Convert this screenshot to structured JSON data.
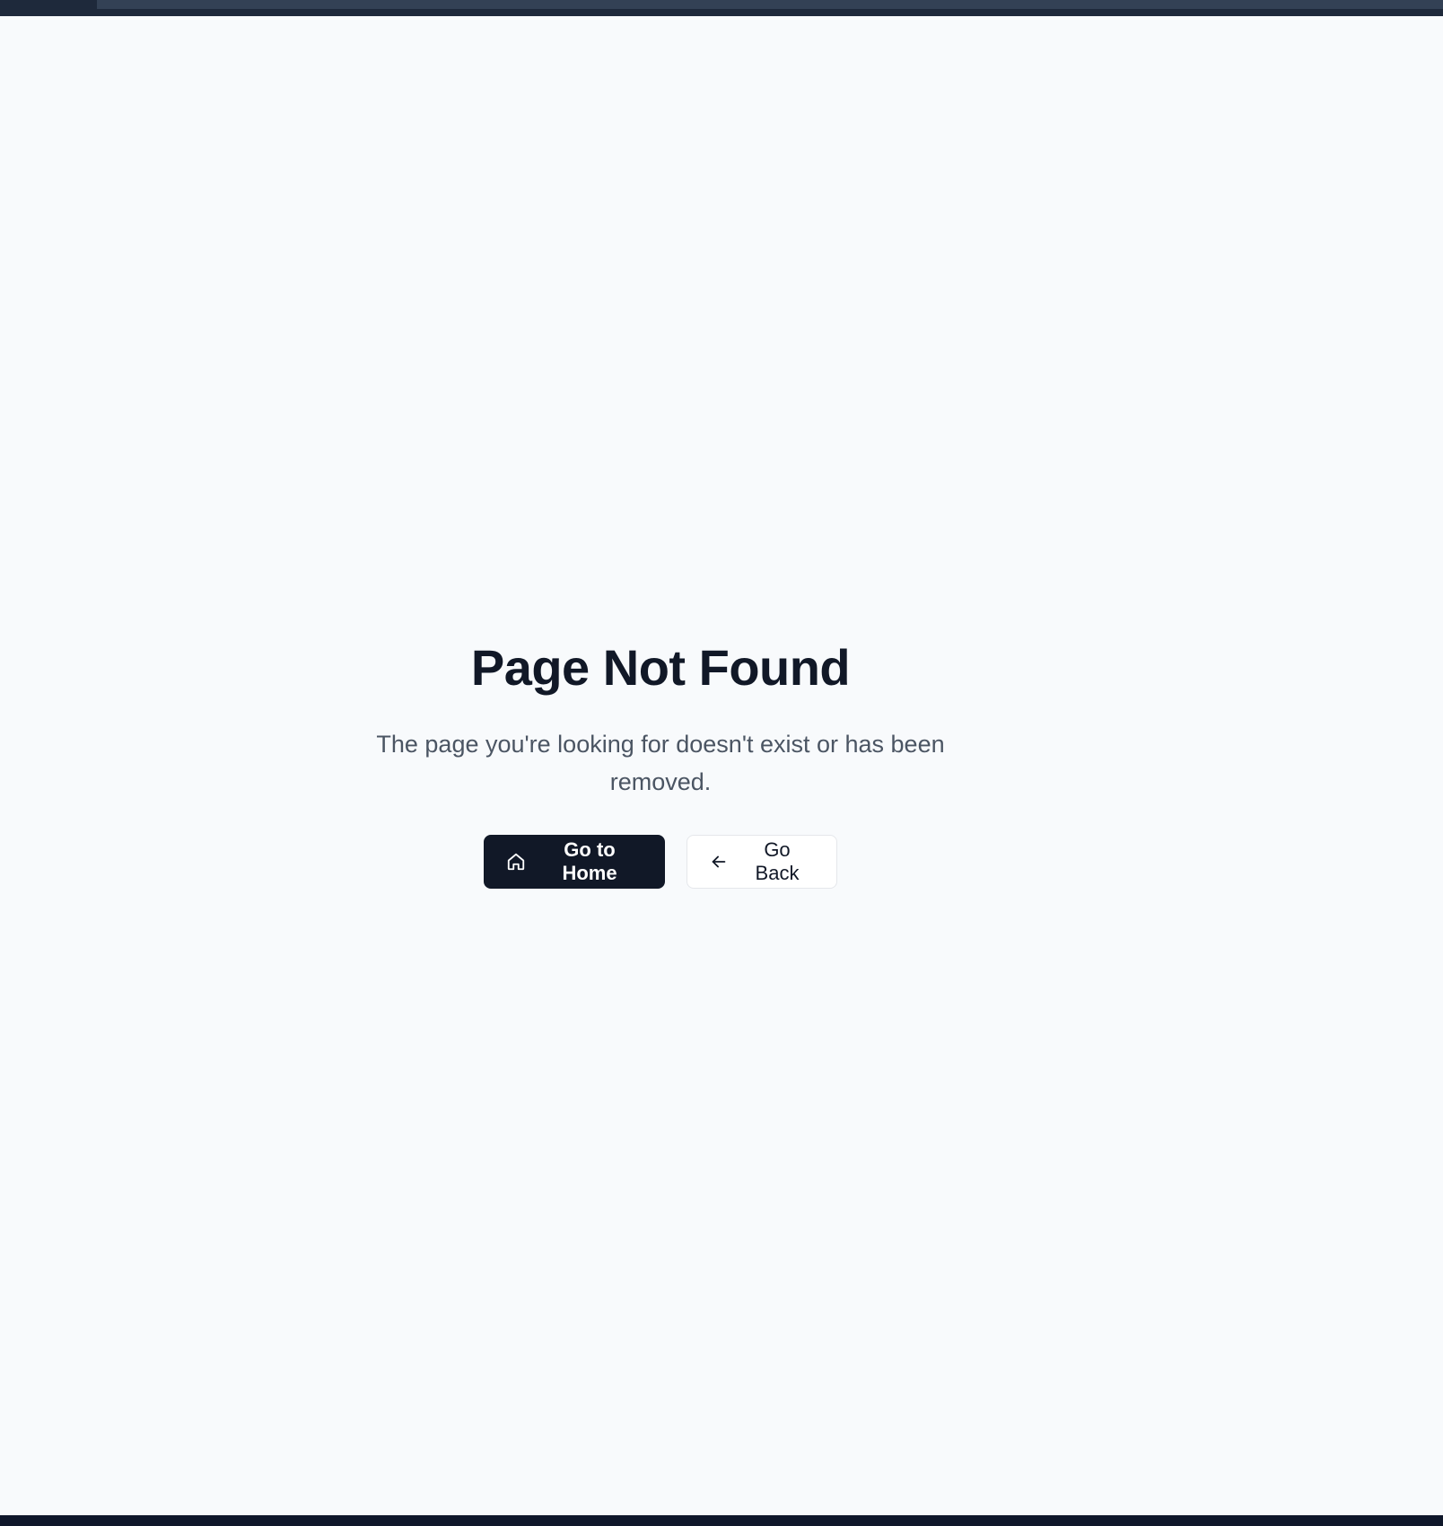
{
  "notFound": {
    "title": "Page Not Found",
    "message": "The page you're looking for doesn't exist or has been removed.",
    "primaryAction": {
      "label": "Go to Home",
      "icon": "home-icon"
    },
    "secondaryAction": {
      "label": "Go Back",
      "icon": "arrow-left-icon"
    }
  },
  "colors": {
    "background": "#f8fafc",
    "title": "#111827",
    "message": "#4b5563",
    "primaryButton": "#111827",
    "secondaryButton": "#ffffff"
  }
}
